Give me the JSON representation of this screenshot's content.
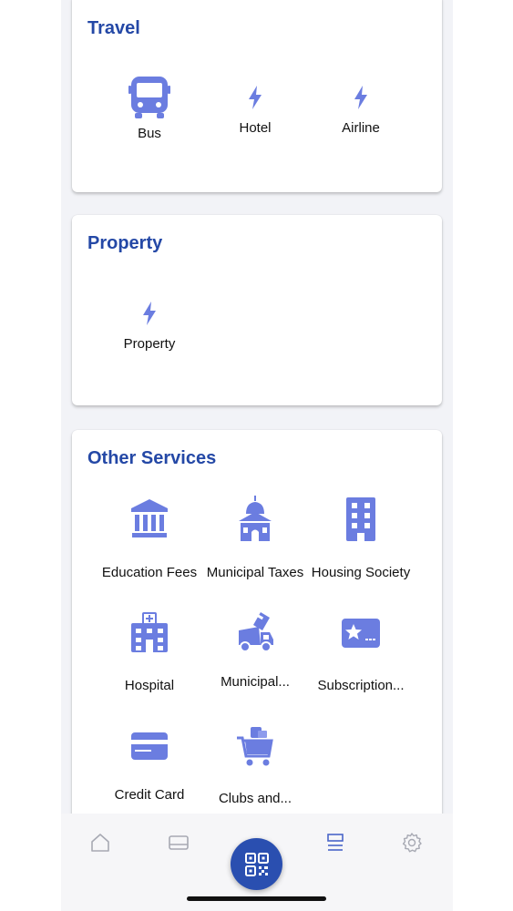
{
  "colors": {
    "accent": "#2a4fb0",
    "title": "#2448a6",
    "icon": "#6b7de0"
  },
  "travel": {
    "title": "Travel",
    "items": [
      {
        "label": "Bus",
        "icon": "bus-icon"
      },
      {
        "label": "Hotel",
        "icon": "bolt-icon"
      },
      {
        "label": "Airline",
        "icon": "bolt-icon"
      }
    ]
  },
  "property": {
    "title": "Property",
    "items": [
      {
        "label": "Property",
        "icon": "bolt-icon"
      }
    ]
  },
  "other_services": {
    "title": "Other Services",
    "items": [
      {
        "label": "Education Fees",
        "icon": "bank-icon"
      },
      {
        "label": "Municipal Taxes",
        "icon": "municipal-building-icon"
      },
      {
        "label": "Housing Society",
        "icon": "apartment-building-icon"
      },
      {
        "label": "Hospital",
        "icon": "hospital-icon"
      },
      {
        "label": "Municipal...",
        "icon": "garbage-truck-icon"
      },
      {
        "label": "Subscription...",
        "icon": "star-card-icon"
      },
      {
        "label": "Credit Card",
        "icon": "credit-card-icon"
      },
      {
        "label": "Clubs and...",
        "icon": "shopping-cart-icon"
      }
    ]
  },
  "bottom_nav": {
    "tabs": [
      "home-icon",
      "card-icon",
      "qr-scan-icon",
      "list-icon",
      "settings-icon"
    ]
  }
}
